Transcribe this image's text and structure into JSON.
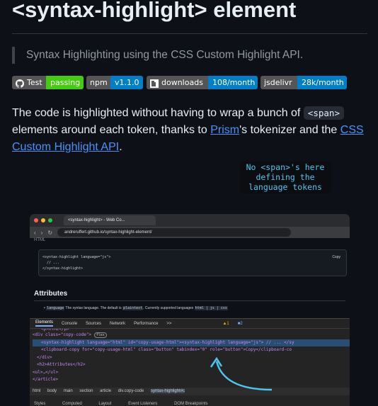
{
  "title": "<syntax-highlight> element",
  "quote": "Syntax Highlighting using the CSS Custom Highlight API.",
  "badges": [
    {
      "label": "Test",
      "value": "passing",
      "color": "#4c1",
      "icon": "github-icon"
    },
    {
      "label": "npm",
      "value": "v1.1.0",
      "color": "#007ec6",
      "icon": ""
    },
    {
      "label": "downloads",
      "value": "108/month",
      "color": "#007ec6",
      "icon": "npm-icon"
    },
    {
      "label": "jsdelivr",
      "value": "28k/month",
      "color": "#007ec6",
      "icon": ""
    }
  ],
  "para": {
    "t1": "The code is highlighted without having to wrap a bunch of ",
    "code": "<span>",
    "t2": " elements around each token, thanks to ",
    "link1": "Prism",
    "t3": "'s tokenizer and the ",
    "link2": "CSS Custom Highlight API",
    "t4": "."
  },
  "shot": {
    "tab_title": "<syntax-highlight> - Web Co...",
    "address": "andreruffert.github.io/syntax-highlight-element/",
    "html_label": "HTML",
    "code_lines": [
      "<syntax-highlight language=\"js\">",
      "  // ...",
      "</syntax-highlight>"
    ],
    "copy": "Copy",
    "attributes_heading": "Attributes",
    "attr_code1": "language",
    "attr_text1": " The syntax language. The default is ",
    "attr_code2": "plaintext",
    "attr_text2": ". Currently supported languages ",
    "attr_code3": "html | js | css",
    "devtools_tabs": [
      "Elements",
      "Console",
      "Sources",
      "Network",
      "Performance",
      ">>"
    ],
    "errors": "▲1",
    "issues": "■2",
    "dom_lines": [
      "<p>HTML</p>",
      "<div class=\"copy-code\">",
      "<syntax-highlight language=\"html\" id=\"copy-usage-html\"><syntax-highlight language=\"js\"> // ... </sy",
      "<clipboard-copy for=\"copy-usage-html\" class=\"button\" tabindex=\"0\" role=\"button\">Copy</clipboard-co",
      "</div>",
      "<h2>Attributes</h2>",
      "<ul>…</ul>",
      "</article>"
    ],
    "flex_badge": "flex",
    "crumbs": [
      "html",
      "body",
      "main",
      "section",
      "article",
      "div.copy-code",
      "syntax-highlight#c"
    ],
    "bottom_tabs": [
      "Styles",
      "Computed",
      "Layout",
      "Event Listeners",
      "DOM Breakpoints"
    ],
    "note": [
      "No <span>'s here",
      "defining the",
      "language tokens"
    ]
  },
  "colors": {
    "accent": "#4493f8",
    "note_text": "#4cc6ee"
  }
}
